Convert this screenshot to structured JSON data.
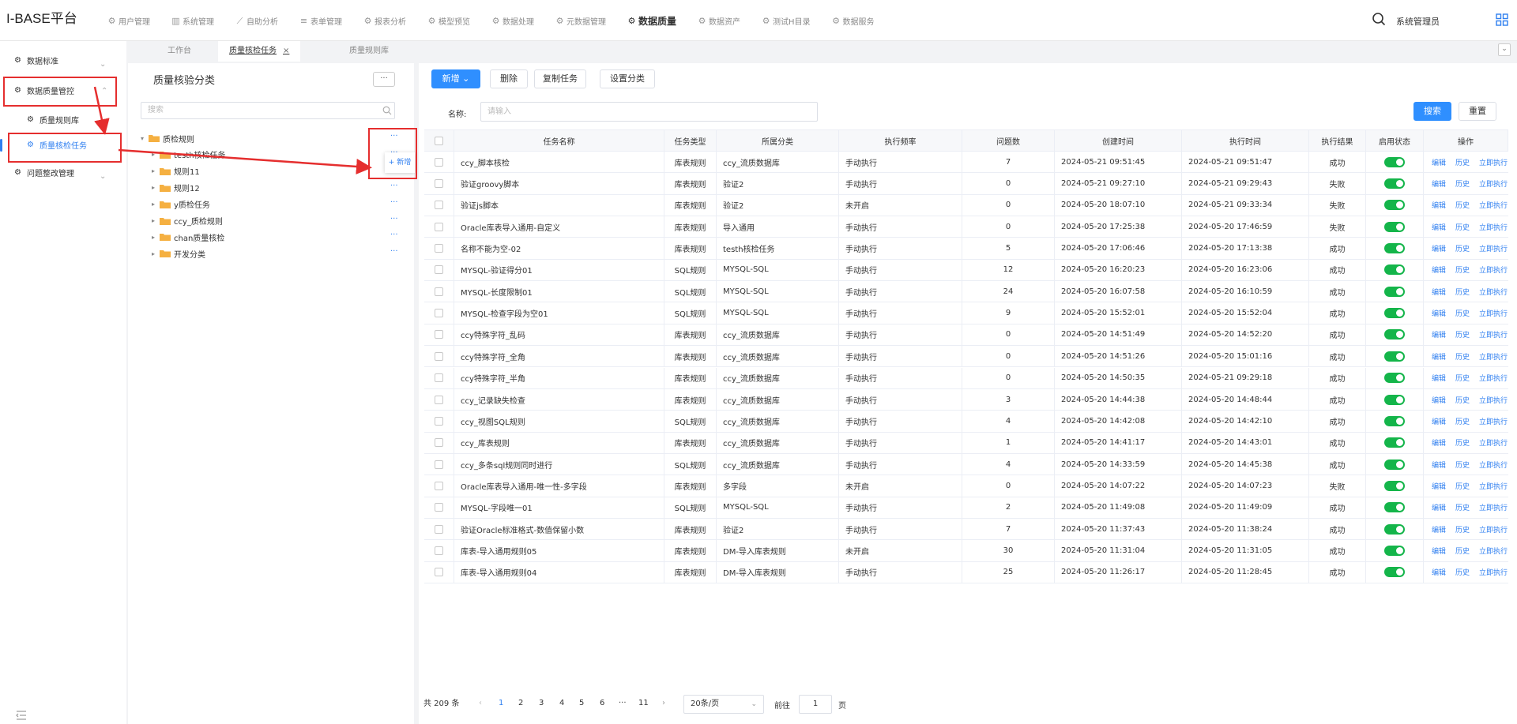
{
  "brand": "I-BASE平台",
  "topnav": [
    {
      "label": "用户管理",
      "icon": "gear-icon"
    },
    {
      "label": "系统管理",
      "icon": "bar-chart-icon"
    },
    {
      "label": "自助分析",
      "icon": "line-chart-icon"
    },
    {
      "label": "表单管理",
      "icon": "list-icon"
    },
    {
      "label": "报表分析",
      "icon": "gear-icon"
    },
    {
      "label": "模型预览",
      "icon": "gear-icon"
    },
    {
      "label": "数据处理",
      "icon": "gear-icon"
    },
    {
      "label": "元数据管理",
      "icon": "gear-icon"
    },
    {
      "label": "数据质量",
      "icon": "gear-icon",
      "active": true
    },
    {
      "label": "数据资产",
      "icon": "gear-icon"
    },
    {
      "label": "测试H目录",
      "icon": "gear-icon"
    },
    {
      "label": "数据服务",
      "icon": "gear-icon"
    }
  ],
  "user": "系统管理员",
  "leftnav": {
    "items": [
      "数据标准",
      "数据质量管控",
      "质量规则库",
      "质量核检任务",
      "问题整改管理"
    ]
  },
  "tabs": [
    {
      "label": "工作台"
    },
    {
      "label": "质量核检任务",
      "close": "×",
      "active": true
    },
    {
      "label": "质量规则库"
    }
  ],
  "category": {
    "title": "质量核验分类",
    "more": "···",
    "search_placeholder": "搜索",
    "popup_add": "+ 新增",
    "tree": [
      {
        "label": "质检规则",
        "level": 0,
        "open": true
      },
      {
        "label": "testh核检任务",
        "level": 1
      },
      {
        "label": "规则11",
        "level": 1
      },
      {
        "label": "规则12",
        "level": 1
      },
      {
        "label": "y质检任务",
        "level": 1
      },
      {
        "label": "ccy_质检规则",
        "level": 1
      },
      {
        "label": "chan质量核检",
        "level": 1
      },
      {
        "label": "开发分类",
        "level": 1
      }
    ],
    "dots": "···"
  },
  "toolbar": {
    "add": "新增",
    "delete": "删除",
    "copy": "复制任务",
    "set_category": "设置分类",
    "search": "搜索",
    "reset": "重置"
  },
  "filter": {
    "label": "名称:",
    "placeholder": "请输入"
  },
  "table": {
    "headers": [
      "任务名称",
      "任务类型",
      "所属分类",
      "执行频率",
      "问题数",
      "创建时间",
      "执行时间",
      "执行结果",
      "启用状态",
      "操作"
    ],
    "ops": [
      "编辑",
      "历史",
      "立即执行"
    ],
    "rows": [
      [
        "ccy_脚本核检",
        "库表规则",
        "ccy_流质数据库",
        "手动执行",
        "7",
        "2024-05-21 09:51:45",
        "2024-05-21 09:51:47",
        "成功"
      ],
      [
        "验证groovy脚本",
        "库表规则",
        "验证2",
        "手动执行",
        "0",
        "2024-05-21 09:27:10",
        "2024-05-21 09:29:43",
        "失败"
      ],
      [
        "验证js脚本",
        "库表规则",
        "验证2",
        "未开启",
        "0",
        "2024-05-20 18:07:10",
        "2024-05-21 09:33:34",
        "失败"
      ],
      [
        "Oracle库表导入通用-自定义",
        "库表规则",
        "导入通用",
        "手动执行",
        "0",
        "2024-05-20 17:25:38",
        "2024-05-20 17:46:59",
        "失败"
      ],
      [
        "名称不能为空-02",
        "库表规则",
        "testh核检任务",
        "手动执行",
        "5",
        "2024-05-20 17:06:46",
        "2024-05-20 17:13:38",
        "成功"
      ],
      [
        "MYSQL-验证得分01",
        "SQL规则",
        "MYSQL-SQL",
        "手动执行",
        "12",
        "2024-05-20 16:20:23",
        "2024-05-20 16:23:06",
        "成功"
      ],
      [
        "MYSQL-长度限制01",
        "SQL规则",
        "MYSQL-SQL",
        "手动执行",
        "24",
        "2024-05-20 16:07:58",
        "2024-05-20 16:10:59",
        "成功"
      ],
      [
        "MYSQL-检查字段为空01",
        "SQL规则",
        "MYSQL-SQL",
        "手动执行",
        "9",
        "2024-05-20 15:52:01",
        "2024-05-20 15:52:04",
        "成功"
      ],
      [
        "ccy特殊字符_乱码",
        "库表规则",
        "ccy_流质数据库",
        "手动执行",
        "0",
        "2024-05-20 14:51:49",
        "2024-05-20 14:52:20",
        "成功"
      ],
      [
        "ccy特殊字符_全角",
        "库表规则",
        "ccy_流质数据库",
        "手动执行",
        "0",
        "2024-05-20 14:51:26",
        "2024-05-20 15:01:16",
        "成功"
      ],
      [
        "ccy特殊字符_半角",
        "库表规则",
        "ccy_流质数据库",
        "手动执行",
        "0",
        "2024-05-20 14:50:35",
        "2024-05-21 09:29:18",
        "成功"
      ],
      [
        "ccy_记录缺失检查",
        "库表规则",
        "ccy_流质数据库",
        "手动执行",
        "3",
        "2024-05-20 14:44:38",
        "2024-05-20 14:48:44",
        "成功"
      ],
      [
        "ccy_视图SQL规则",
        "SQL规则",
        "ccy_流质数据库",
        "手动执行",
        "4",
        "2024-05-20 14:42:08",
        "2024-05-20 14:42:10",
        "成功"
      ],
      [
        "ccy_库表规则",
        "库表规则",
        "ccy_流质数据库",
        "手动执行",
        "1",
        "2024-05-20 14:41:17",
        "2024-05-20 14:43:01",
        "成功"
      ],
      [
        "ccy_多条sql规则同时进行",
        "SQL规则",
        "ccy_流质数据库",
        "手动执行",
        "4",
        "2024-05-20 14:33:59",
        "2024-05-20 14:45:38",
        "成功"
      ],
      [
        "Oracle库表导入通用-唯一性-多字段",
        "库表规则",
        "多字段",
        "未开启",
        "0",
        "2024-05-20 14:07:22",
        "2024-05-20 14:07:23",
        "失败"
      ],
      [
        "MYSQL-字段唯一01",
        "SQL规则",
        "MYSQL-SQL",
        "手动执行",
        "2",
        "2024-05-20 11:49:08",
        "2024-05-20 11:49:09",
        "成功"
      ],
      [
        "验证Oracle标准格式-数值保留小数",
        "库表规则",
        "验证2",
        "手动执行",
        "7",
        "2024-05-20 11:37:43",
        "2024-05-20 11:38:24",
        "成功"
      ],
      [
        "库表-导入通用规则05",
        "库表规则",
        "DM-导入库表规则",
        "未开启",
        "30",
        "2024-05-20 11:31:04",
        "2024-05-20 11:31:05",
        "成功"
      ],
      [
        "库表-导入通用规则04",
        "库表规则",
        "DM-导入库表规则",
        "手动执行",
        "25",
        "2024-05-20 11:26:17",
        "2024-05-20 11:28:45",
        "成功"
      ]
    ]
  },
  "pager": {
    "total": "共 209 条",
    "pages": [
      "1",
      "2",
      "3",
      "4",
      "5",
      "6",
      "···",
      "11"
    ],
    "prev": "‹",
    "next": "›",
    "size": "20条/页",
    "goto_label": "前往",
    "goto_value": "1",
    "page_suffix": "页"
  },
  "colors": {
    "primary": "#2f8fff",
    "link": "#2f7ff0",
    "toggle_on": "#14b54a",
    "annotation": "#e52e2e"
  }
}
